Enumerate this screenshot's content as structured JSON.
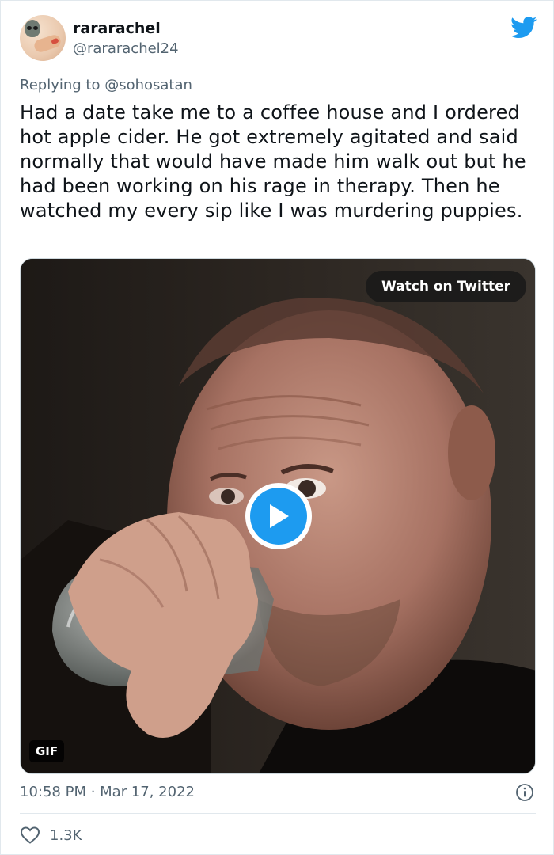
{
  "author": {
    "display_name": "rararachel",
    "handle": "@rararachel24"
  },
  "reply": {
    "prefix": "Replying to ",
    "mention": "@sohosatan"
  },
  "tweet": {
    "text": "Had a date take me to a coffee house and I ordered hot apple cider. He got extremely agitated and said normally that would have made him walk out but he had been working on his rage in therapy. Then he watched my every sip like I was murdering puppies."
  },
  "media": {
    "watch_label": "Watch on Twitter",
    "badge": "GIF"
  },
  "meta": {
    "timestamp": "10:58 PM · Mar 17, 2022"
  },
  "engagement": {
    "likes": "1.3K"
  },
  "icons": {
    "brand": "twitter-bird-icon",
    "play": "play-icon",
    "info": "info-icon",
    "like": "heart-icon"
  },
  "colors": {
    "accent": "#1d9bf0",
    "text": "#0f1419",
    "muted": "#536471"
  }
}
